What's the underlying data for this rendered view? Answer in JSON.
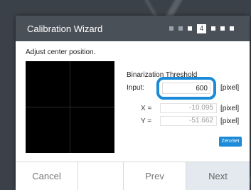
{
  "dialog": {
    "title": "Calibration Wizard",
    "steps": {
      "current_label": "4"
    }
  },
  "instruction": "Adjust center position.",
  "threshold": {
    "heading": "Binarization Threshold",
    "input_label": "Input:",
    "value": "600",
    "unit": "[pixel]"
  },
  "coords": {
    "x_label": "X =",
    "x_value": "-10.095",
    "x_unit": "[pixel]",
    "y_label": "Y =",
    "y_value": "-51.662",
    "y_unit": "[pixel]"
  },
  "zeroset_label": "ZeroSet",
  "footer": {
    "cancel": "Cancel",
    "prev": "Prev",
    "next": "Next"
  },
  "colors": {
    "accent": "#1b8ad8",
    "titlebar": "#4a5058"
  }
}
